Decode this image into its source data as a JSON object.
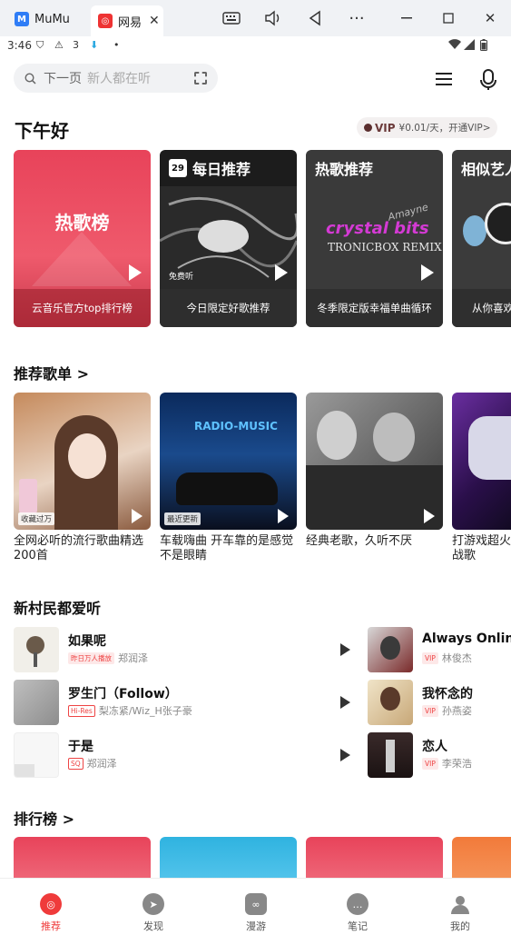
{
  "window": {
    "tabs": [
      {
        "label": "MuMu"
      },
      {
        "label": "网易"
      }
    ]
  },
  "status": {
    "time": "3:46",
    "icon_text": "3"
  },
  "search": {
    "current": "下一页",
    "placeholder": "新人都在听"
  },
  "greeting": "下午好",
  "vip": {
    "label": "VIP",
    "text": "¥0.01/天，开通VIP>"
  },
  "top_cards": [
    {
      "title": "热歌榜",
      "caption": "云音乐官方top排行榜",
      "badge": ""
    },
    {
      "title": "每日推荐",
      "date": "29",
      "caption": "今日限定好歌推荐",
      "badge": "免费听"
    },
    {
      "title": "热歌推荐",
      "art_line1": "crystal bits",
      "art_line2": "TRONICBOX REMIX",
      "art_sub": "Amayne",
      "caption": "冬季限定版幸福单曲循环",
      "badge": ""
    },
    {
      "title": "相似艺人",
      "caption": "从你喜欢",
      "badge": ""
    }
  ],
  "sections": {
    "playlists": "推荐歌单 >",
    "new_users": "新村民都爱听",
    "charts": "排行榜 >"
  },
  "playlists": [
    {
      "tag": "收藏过万",
      "title": "全网必听的流行歌曲精选200首"
    },
    {
      "tag": "最近更新",
      "title": "车载嗨曲 开车靠的是感觉不是眼睛",
      "art_text": "RADIO-MUSIC"
    },
    {
      "tag": "",
      "title": "经典老歌，久听不厌"
    },
    {
      "tag": "",
      "title": "打游戏超火战歌"
    }
  ],
  "songs_left": [
    {
      "title": "如果呢",
      "tag": "昨日万人播放",
      "artist": "郑润泽"
    },
    {
      "title": "罗生门（Follow）",
      "tag": "Hi-Res",
      "artist": "梨冻紧/Wiz_H张子豪"
    },
    {
      "title": "于是",
      "tag": "SQ",
      "artist": "郑润泽"
    }
  ],
  "songs_right": [
    {
      "title": "Always Online",
      "tag": "VIP",
      "artist": "林俊杰"
    },
    {
      "title": "我怀念的",
      "tag": "VIP",
      "artist": "孙燕姿"
    },
    {
      "title": "恋人",
      "tag": "VIP",
      "artist": "李荣浩"
    }
  ],
  "nav": [
    {
      "label": "推荐"
    },
    {
      "label": "发现"
    },
    {
      "label": "漫游"
    },
    {
      "label": "笔记"
    },
    {
      "label": "我的"
    }
  ],
  "colors": {
    "accent": "#ef3b3b",
    "hot_card": "#e8435a"
  }
}
